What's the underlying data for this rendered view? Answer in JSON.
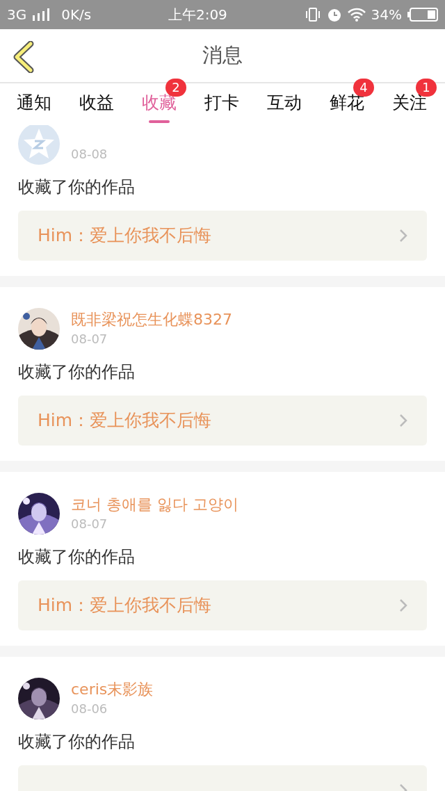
{
  "status_bar": {
    "network": "3G",
    "speed": "0K/s",
    "time": "上午2:09",
    "battery": "34%"
  },
  "header": {
    "title": "消息"
  },
  "tabs": [
    {
      "label": "通知",
      "selected": false
    },
    {
      "label": "收益",
      "selected": false
    },
    {
      "label": "收藏",
      "selected": true,
      "badge": "2"
    },
    {
      "label": "打卡",
      "selected": false
    },
    {
      "label": "互动",
      "selected": false
    },
    {
      "label": "鲜花",
      "selected": false,
      "badge": "4"
    },
    {
      "label": "关注",
      "selected": false,
      "badge": "1"
    }
  ],
  "items": [
    {
      "kind": "default",
      "date": "08-08",
      "text": "收藏了你的作品",
      "work": "Him：爱上你我不后悔"
    },
    {
      "kind": "picture",
      "name": "既非梁祝怎生化蝶8327",
      "date": "08-07",
      "text": "收藏了你的作品",
      "work": "Him：爱上你我不后悔"
    },
    {
      "kind": "picture",
      "name": "코너 총애를 잃다 고양이",
      "date": "08-07",
      "text": "收藏了你的作品",
      "work": "Him：爱上你我不后悔"
    },
    {
      "kind": "picture",
      "name": "ceris末影族",
      "date": "08-06",
      "text": "收藏了你的作品"
    }
  ]
}
